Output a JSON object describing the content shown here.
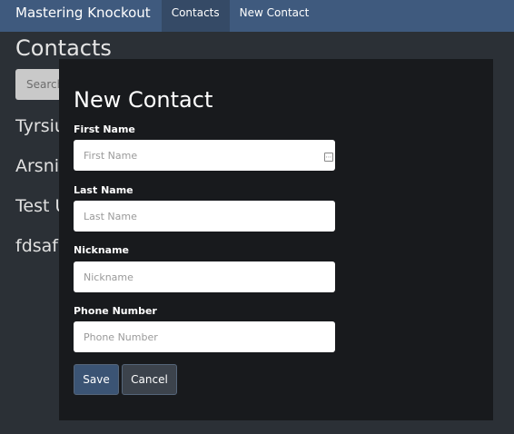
{
  "navbar": {
    "brand": "Mastering Knockout",
    "links": [
      {
        "label": "Contacts"
      },
      {
        "label": "New Contact"
      }
    ]
  },
  "page": {
    "title": "Contacts",
    "search_placeholder": "Search",
    "contacts": [
      "Tyrsius",
      "Arsnick",
      "Test User",
      "fdsafdsa"
    ]
  },
  "modal": {
    "title": "New Contact",
    "fields": [
      {
        "label": "First Name",
        "placeholder": "First Name",
        "value": ""
      },
      {
        "label": "Last Name",
        "placeholder": "Last Name",
        "value": ""
      },
      {
        "label": "Nickname",
        "placeholder": "Nickname",
        "value": ""
      },
      {
        "label": "Phone Number",
        "placeholder": "Phone Number",
        "value": ""
      }
    ],
    "save_label": "Save",
    "cancel_label": "Cancel"
  },
  "colors": {
    "navbar": "#3f5a7e",
    "background": "#2b3036",
    "modal": "#181a1d",
    "save_button": "#3b5474",
    "cancel_button": "#3c434c"
  },
  "icons": {
    "first_name_field": "autofill-icon"
  }
}
